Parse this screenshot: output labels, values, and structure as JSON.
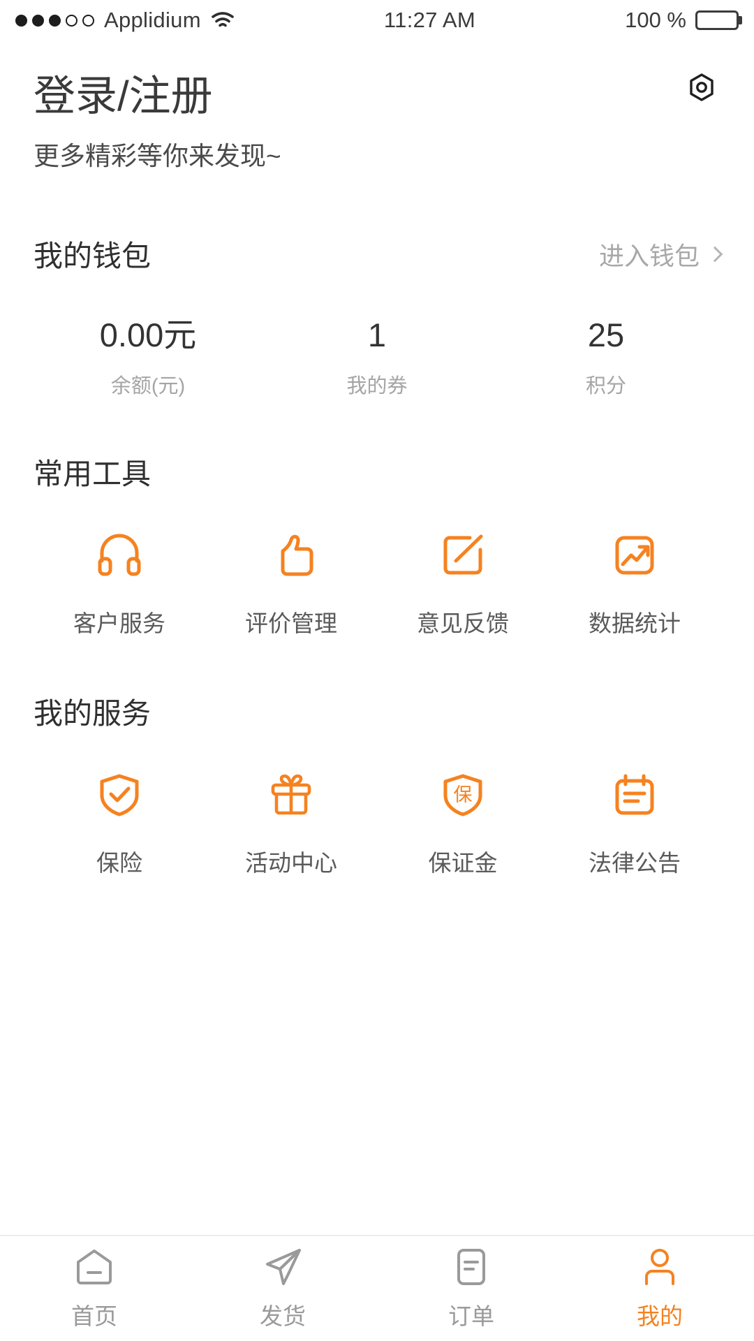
{
  "status_bar": {
    "signal_dots_filled": 3,
    "signal_dots_total": 5,
    "carrier": "Applidium",
    "wifi_icon": "wifi-icon",
    "time": "11:27 AM",
    "battery_percent": "100 %",
    "battery_icon": "battery-full-icon"
  },
  "header": {
    "title": "登录/注册",
    "subtitle": "更多精彩等你来发现~",
    "settings_icon": "settings-hex-icon"
  },
  "wallet": {
    "section_title": "我的钱包",
    "enter_label": "进入钱包",
    "chevron_icon": "chevron-right-icon",
    "stats": [
      {
        "value": "0.00元",
        "label": "余额(元)",
        "name": "balance"
      },
      {
        "value": "1",
        "label": "我的券",
        "name": "coupons"
      },
      {
        "value": "25",
        "label": "积分",
        "name": "points"
      }
    ]
  },
  "tools": {
    "section_title": "常用工具",
    "items": [
      {
        "label": "客户服务",
        "icon": "headphones-icon"
      },
      {
        "label": "评价管理",
        "icon": "thumbs-up-icon"
      },
      {
        "label": "意见反馈",
        "icon": "edit-square-icon"
      },
      {
        "label": "数据统计",
        "icon": "trend-chart-icon"
      }
    ]
  },
  "services": {
    "section_title": "我的服务",
    "items": [
      {
        "label": "保险",
        "icon": "shield-check-icon"
      },
      {
        "label": "活动中心",
        "icon": "gift-icon"
      },
      {
        "label": "保证金",
        "icon": "shield-bao-icon"
      },
      {
        "label": "法律公告",
        "icon": "notice-board-icon"
      }
    ]
  },
  "tabbar": {
    "items": [
      {
        "label": "首页",
        "icon": "home-icon",
        "active": false
      },
      {
        "label": "发货",
        "icon": "paper-plane-icon",
        "active": false
      },
      {
        "label": "订单",
        "icon": "order-doc-icon",
        "active": false
      },
      {
        "label": "我的",
        "icon": "user-icon",
        "active": true
      }
    ]
  },
  "colors": {
    "accent": "#f58220",
    "text_primary": "#333333",
    "text_secondary": "#5a5a5a",
    "text_muted": "#a5a5a5",
    "background": "#ffffff"
  }
}
